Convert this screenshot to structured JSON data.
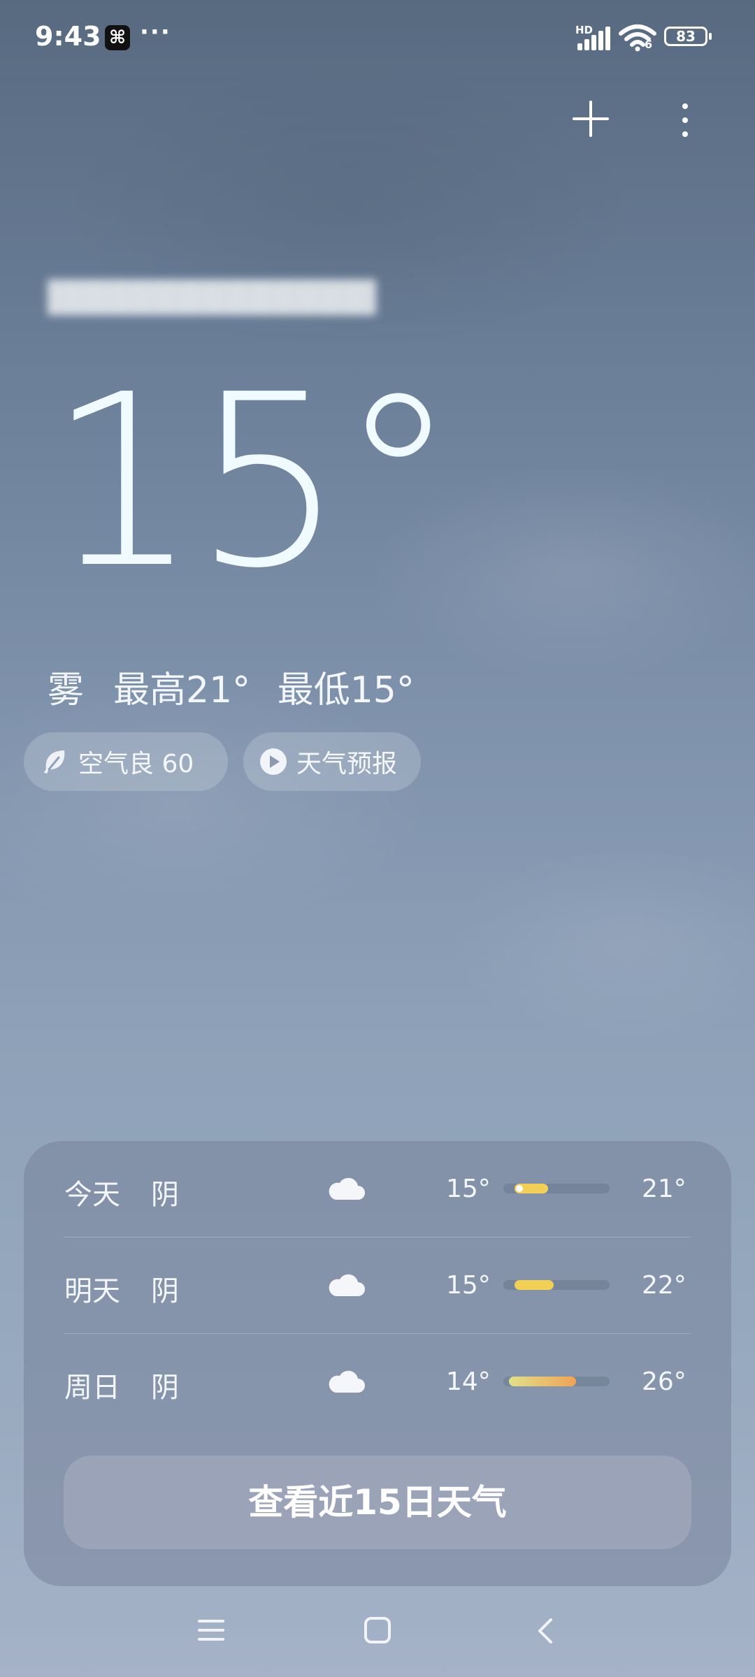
{
  "status_bar": {
    "time": "9:43",
    "app_badge": "⌘",
    "more": "···",
    "network": "HD",
    "wifi_sub": "6",
    "battery": "83"
  },
  "location": {
    "name": "████████████████"
  },
  "current": {
    "temperature": "15°",
    "condition": "雾",
    "high": "最高21°",
    "low": "最低15°"
  },
  "pills": {
    "aqi_label": "空气良 60",
    "forecast_label": "天气预报"
  },
  "forecast": {
    "days": [
      {
        "day": "今天",
        "condition": "阴",
        "icon": "cloud-icon",
        "low": "15°",
        "high": "21°",
        "range_low": 15,
        "range_high": 21,
        "current": 15
      },
      {
        "day": "明天",
        "condition": "阴",
        "icon": "cloud-icon",
        "low": "15°",
        "high": "22°",
        "range_low": 15,
        "range_high": 22
      },
      {
        "day": "周日",
        "condition": "阴",
        "icon": "cloud-icon",
        "low": "14°",
        "high": "26°",
        "range_low": 14,
        "range_high": 26
      }
    ],
    "scale_min": 13,
    "scale_max": 32,
    "button_label": "查看近15日天气"
  },
  "nav": {
    "icons": [
      "menu-icon",
      "home-icon",
      "back-icon"
    ]
  },
  "colors": {
    "bar_yellow": "#f2cf55",
    "bar_orange": "#f0a354",
    "bar_green_yellow": "#e0e08a"
  }
}
